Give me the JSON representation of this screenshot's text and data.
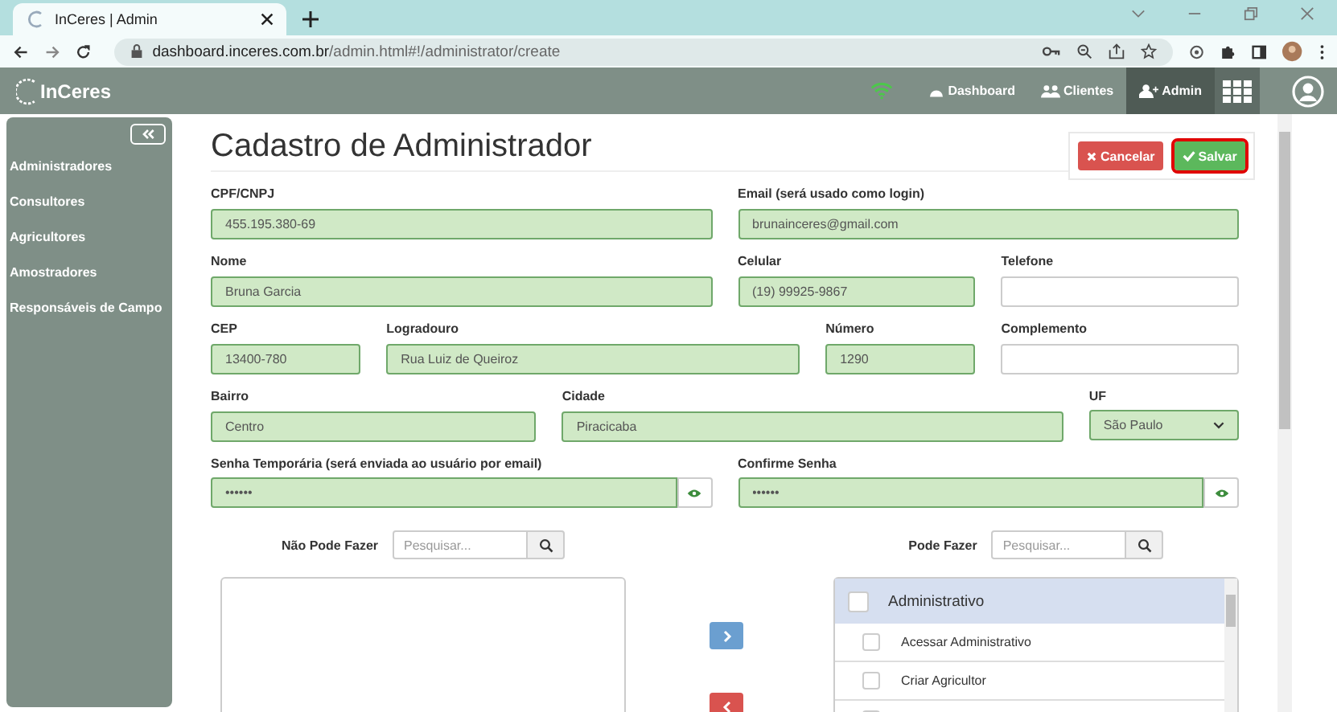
{
  "browser": {
    "tab_title": "InCeres | Admin",
    "url_host": "dashboard.inceres.com.br",
    "url_path": "/admin.html#!/administrator/create"
  },
  "navbar": {
    "brand": "InCeres",
    "items": [
      {
        "label": "Dashboard",
        "kind": "dashboard",
        "selected": false
      },
      {
        "label": "Clientes",
        "kind": "clients",
        "selected": false
      },
      {
        "label": "Admin",
        "kind": "admin",
        "selected": true
      }
    ]
  },
  "sidebar": {
    "items": [
      "Administradores",
      "Consultores",
      "Agricultores",
      "Amostradores",
      "Responsáveis de Campo"
    ]
  },
  "page": {
    "title": "Cadastro de Administrador",
    "actions": [
      {
        "label": "Cancelar",
        "kind": "cancel",
        "focused": false
      },
      {
        "label": "Salvar",
        "kind": "save",
        "focused": true
      }
    ]
  },
  "form": [
    [
      {
        "label": "CPF/CNPJ",
        "kind": "text",
        "value": "455.195.380-69",
        "valid": true
      },
      {
        "label": "Email (será usado como login)",
        "kind": "text",
        "value": "brunainceres@gmail.com",
        "valid": true
      }
    ],
    [
      {
        "label": "Nome",
        "kind": "text",
        "value": "Bruna Garcia",
        "valid": true
      },
      {
        "label": "Celular",
        "kind": "text",
        "value": "(19) 99925-9867",
        "valid": true
      },
      {
        "label": "Telefone",
        "kind": "text",
        "valid": false
      }
    ],
    [
      {
        "label": "CEP",
        "kind": "text",
        "value": "13400-780",
        "valid": true
      },
      {
        "label": "Logradouro",
        "kind": "text",
        "value": "Rua Luiz de Queiroz",
        "valid": true
      },
      {
        "label": "Número",
        "kind": "text",
        "value": "1290",
        "valid": true
      },
      {
        "label": "Complemento",
        "kind": "text",
        "valid": false
      }
    ],
    [
      {
        "label": "Bairro",
        "kind": "text",
        "value": "Centro",
        "valid": true
      },
      {
        "label": "Cidade",
        "kind": "text",
        "value": "Piracicaba",
        "valid": true
      },
      {
        "label": "UF",
        "kind": "select",
        "value": "São Paulo",
        "valid": true
      }
    ],
    [
      {
        "label": "Senha Temporária (será enviada ao usuário por email)",
        "kind": "password",
        "value": "••••••",
        "valid": true
      },
      {
        "label": "Confirme Senha",
        "kind": "password",
        "value": "••••••",
        "valid": true
      }
    ]
  ],
  "permissions": {
    "denied": {
      "label": "Não Pode Fazer",
      "placeholder": "Pesquisar..."
    },
    "granted": {
      "label": "Pode Fazer",
      "placeholder": "Pesquisar...",
      "groups": [
        {
          "label": "Administrativo",
          "checked": false,
          "items": [
            {
              "label": "Acessar Administrativo",
              "checked": false
            },
            {
              "label": "Criar Agricultor",
              "checked": false
            },
            {
              "checked": false
            }
          ]
        }
      ]
    }
  }
}
